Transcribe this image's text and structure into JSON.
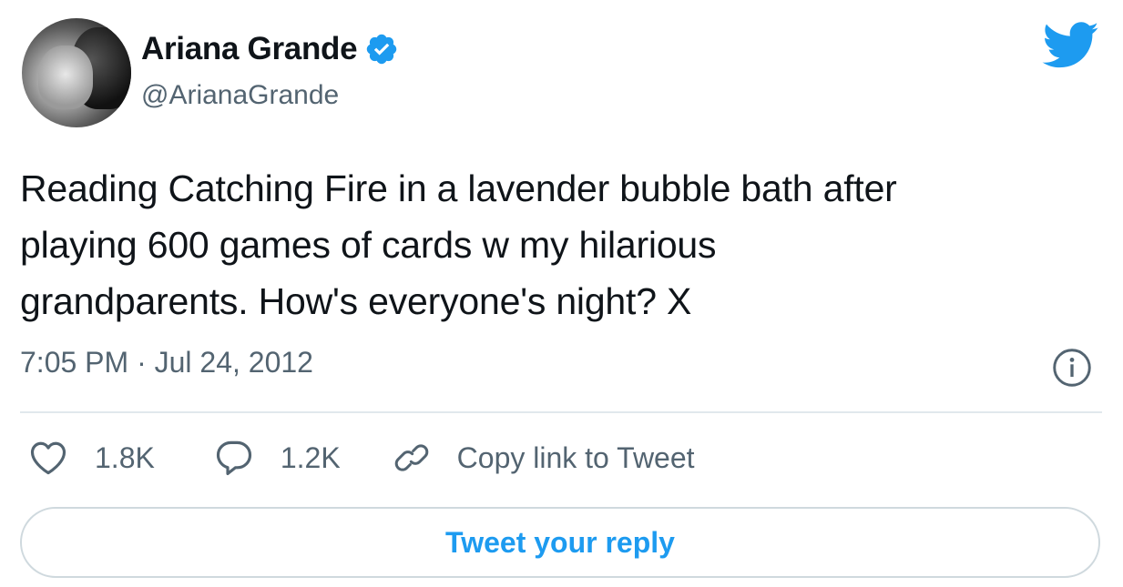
{
  "author": {
    "name": "Ariana Grande",
    "handle": "@ArianaGrande",
    "verified": true
  },
  "tweet": {
    "text": "Reading Catching Fire in a lavender bubble bath after\nplaying 600 games of cards w my hilarious\ngrandparents. How's everyone's night? X",
    "timestamp": "7:05 PM · Jul 24, 2012"
  },
  "actions": {
    "likes": "1.8K",
    "replies": "1.2K",
    "copy_link_label": "Copy link to Tweet"
  },
  "reply_button_label": "Tweet your reply",
  "colors": {
    "brand_blue": "#1d9bf0",
    "secondary_text": "#536471",
    "border": "#cfd9de"
  },
  "icons": [
    "twitter-bird-icon",
    "verified-badge-icon",
    "info-icon",
    "heart-icon",
    "reply-bubble-icon",
    "link-icon"
  ]
}
